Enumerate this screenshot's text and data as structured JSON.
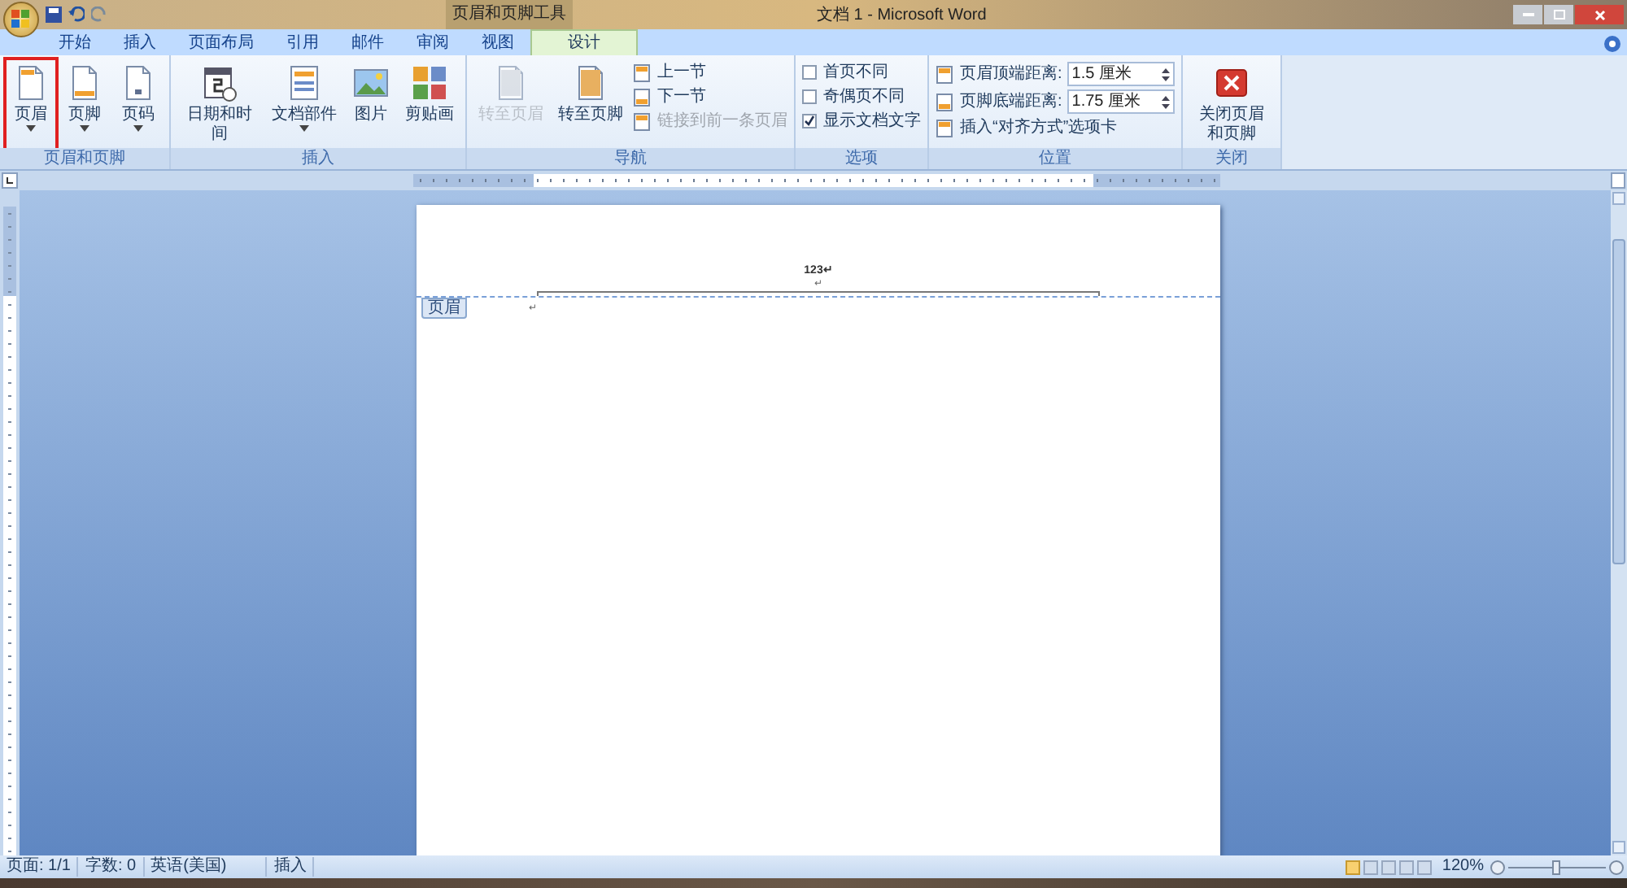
{
  "window": {
    "title": "文档 1 - Microsoft Word",
    "context_label": "页眉和页脚工具"
  },
  "tabs": [
    {
      "label": "开始",
      "selected": false
    },
    {
      "label": "插入",
      "selected": false
    },
    {
      "label": "页面布局",
      "selected": false
    },
    {
      "label": "引用",
      "selected": false
    },
    {
      "label": "邮件",
      "selected": false
    },
    {
      "label": "审阅",
      "selected": false
    },
    {
      "label": "视图",
      "selected": false
    },
    {
      "label": "设计",
      "selected": true
    }
  ],
  "ribbon": [
    {
      "label": "页眉和页脚",
      "items": [
        {
          "kind": "large",
          "label": "页眉",
          "dropdown": true,
          "disabled": false,
          "outlined": true
        },
        {
          "kind": "large",
          "label": "页脚",
          "dropdown": true,
          "disabled": false,
          "outlined": false
        },
        {
          "kind": "large",
          "label": "页码",
          "dropdown": true,
          "disabled": false,
          "outlined": false
        }
      ]
    },
    {
      "label": "插入",
      "items": [
        {
          "kind": "large",
          "label": "日期和时间",
          "dropdown": false,
          "disabled": false,
          "outlined": false
        },
        {
          "kind": "large",
          "label": "文档部件",
          "dropdown": true,
          "disabled": false,
          "outlined": false
        },
        {
          "kind": "large",
          "label": "图片",
          "dropdown": false,
          "disabled": false,
          "outlined": false
        },
        {
          "kind": "large",
          "label": "剪贴画",
          "dropdown": false,
          "disabled": false,
          "outlined": false
        }
      ]
    },
    {
      "label": "导航",
      "items": [
        {
          "kind": "large",
          "label": "转至页眉",
          "dropdown": false,
          "disabled": true,
          "outlined": false
        },
        {
          "kind": "large",
          "label": "转至页脚",
          "dropdown": false,
          "disabled": false,
          "outlined": false
        },
        {
          "kind": "small",
          "label": "上一节",
          "disabled": false
        },
        {
          "kind": "small",
          "label": "下一节",
          "disabled": false
        },
        {
          "kind": "small",
          "label": "链接到前一条页眉",
          "disabled": true
        }
      ]
    },
    {
      "label": "选项",
      "items": [
        {
          "kind": "check",
          "label": "首页不同",
          "checked": false
        },
        {
          "kind": "check",
          "label": "奇偶页不同",
          "checked": false
        },
        {
          "kind": "check",
          "label": "显示文档文字",
          "checked": true
        }
      ]
    },
    {
      "label": "位置",
      "items": [
        {
          "kind": "spin",
          "label": "页眉顶端距离:",
          "value": "1.5 厘米"
        },
        {
          "kind": "spin",
          "label": "页脚底端距离:",
          "value": "1.75 厘米"
        },
        {
          "kind": "small",
          "label": "插入“对齐方式”选项卡",
          "disabled": false
        }
      ]
    },
    {
      "label": "关闭",
      "items": [
        {
          "kind": "large",
          "label": "关闭页眉和页脚",
          "dropdown": false,
          "disabled": false,
          "outlined": false
        }
      ]
    }
  ],
  "document": {
    "header_lines": [
      "123↵",
      "↵"
    ],
    "header_tag": "页眉",
    "body_mark": "↵"
  },
  "status_bar": {
    "items": [
      "页面: 1/1",
      "字数: 0",
      "英语(美国)",
      "插入"
    ],
    "zoom": "120%",
    "level": 0.5
  }
}
